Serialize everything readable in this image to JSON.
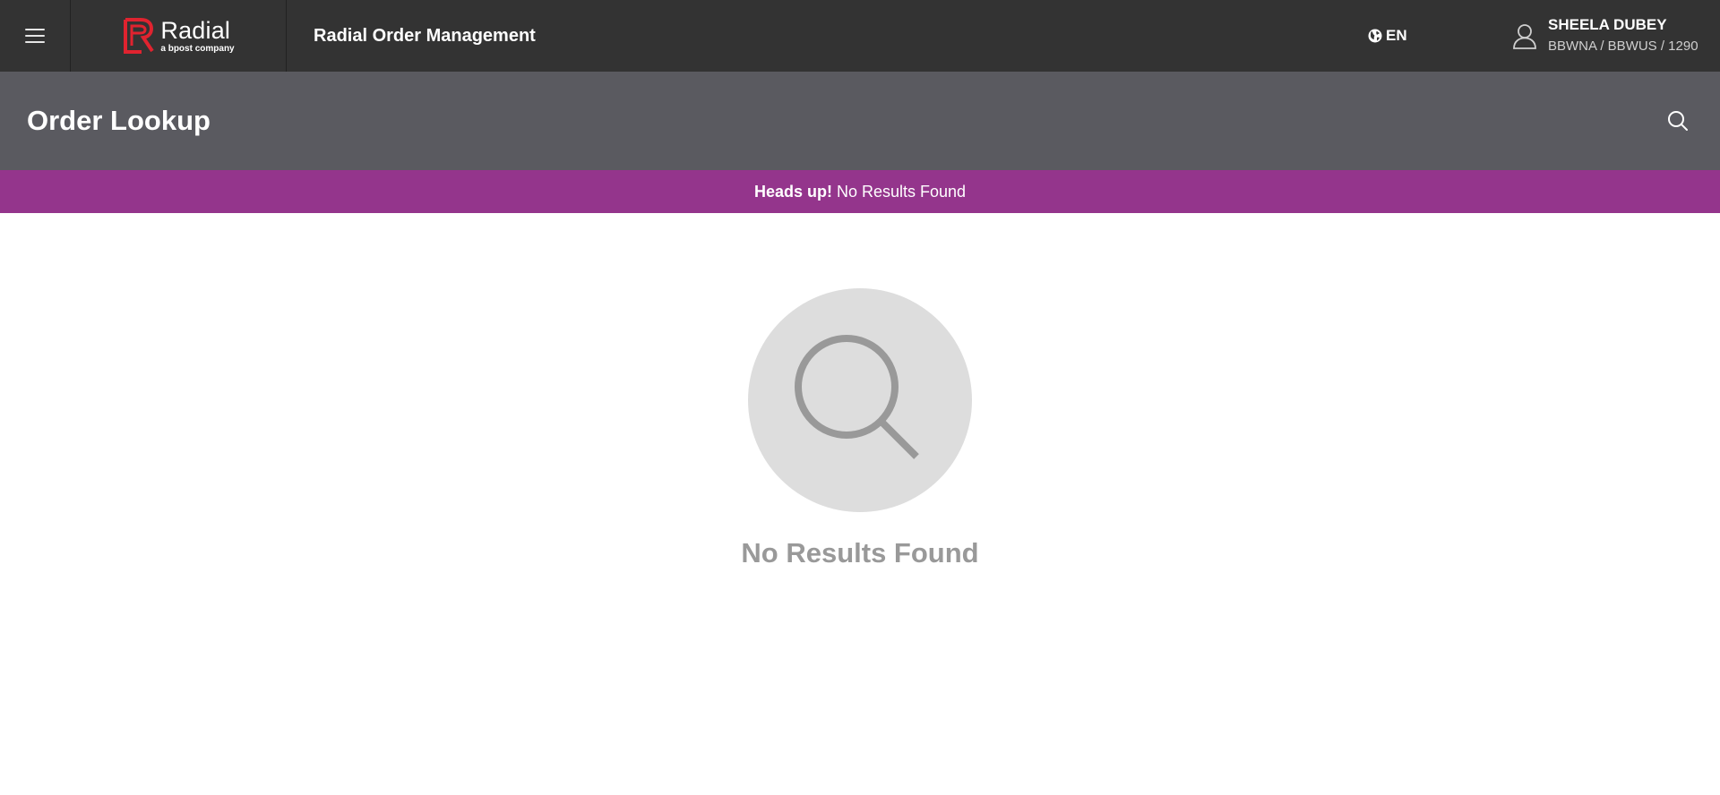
{
  "topbar": {
    "menu_icon": "hamburger-menu-icon",
    "logo": {
      "name": "Radial",
      "tagline": "a bpost company",
      "brand_color": "#e0232f"
    },
    "app_title": "Radial Order Management",
    "language": {
      "icon": "globe-icon",
      "code": "EN"
    },
    "user": {
      "icon": "user-icon",
      "name": "SHEELA DUBEY",
      "org": "BBWNA / BBWUS / 1290"
    }
  },
  "page_header": {
    "title": "Order Lookup",
    "search_icon": "search-icon"
  },
  "alert": {
    "strong": "Heads up!",
    "message": "No Results Found",
    "color": "#94358c"
  },
  "empty_state": {
    "icon": "magnifier-icon",
    "message": "No Results Found"
  }
}
